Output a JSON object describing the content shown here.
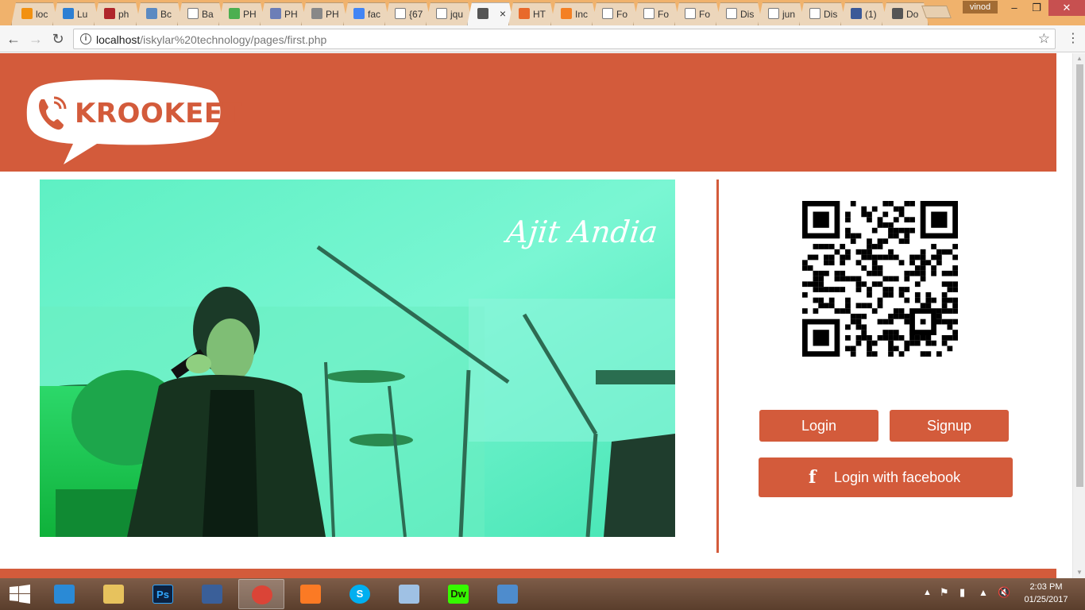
{
  "browser": {
    "tabs": [
      {
        "label": "loc",
        "icon": "phpmyadmin-icon",
        "color": "#f29111"
      },
      {
        "label": "Lu",
        "icon": "blue-app-icon",
        "color": "#2d7fd3"
      },
      {
        "label": "ph",
        "icon": "wdg-icon",
        "color": "#b0262b"
      },
      {
        "label": "Bc",
        "icon": "bootstrap-icon",
        "color": "#5b8ac2"
      },
      {
        "label": "Ba",
        "icon": "page-icon",
        "color": "#ffffff"
      },
      {
        "label": "PH",
        "icon": "w3-icon",
        "color": "#4caf50"
      },
      {
        "label": "PH",
        "icon": "php-icon",
        "color": "#6c7eb7"
      },
      {
        "label": "PH",
        "icon": "diamond-icon",
        "color": "#888888"
      },
      {
        "label": "fac",
        "icon": "google-icon",
        "color": "#4285f4"
      },
      {
        "label": "{67",
        "icon": "page-icon",
        "color": "#ffffff"
      },
      {
        "label": "jqu",
        "icon": "page-icon",
        "color": "#ffffff"
      },
      {
        "label": "",
        "icon": "speaker-icon",
        "color": "#555555",
        "active": true
      },
      {
        "label": "HT",
        "icon": "html-icon",
        "color": "#e8692b"
      },
      {
        "label": "Inc",
        "icon": "stackoverflow-icon",
        "color": "#f48024"
      },
      {
        "label": "Fo",
        "icon": "page-icon",
        "color": "#ffffff"
      },
      {
        "label": "Fo",
        "icon": "page-icon",
        "color": "#ffffff"
      },
      {
        "label": "Fo",
        "icon": "page-icon",
        "color": "#ffffff"
      },
      {
        "label": "Dis",
        "icon": "page-icon",
        "color": "#ffffff"
      },
      {
        "label": "jun",
        "icon": "page-icon",
        "color": "#ffffff"
      },
      {
        "label": "Dis",
        "icon": "page-icon",
        "color": "#ffffff"
      },
      {
        "label": "(1)",
        "icon": "facebook-icon",
        "color": "#3b5998"
      },
      {
        "label": "Do",
        "icon": "download-icon",
        "color": "#555555"
      }
    ],
    "user": "vinod",
    "url_host": "localhost",
    "url_path": "/iskylar%20technology/pages/first.php"
  },
  "site": {
    "brand": "KROOKEET",
    "hero_caption": "Ajit Andia",
    "login_label": "Login",
    "signup_label": "Signup",
    "facebook_label": "Login with facebook",
    "accent_color": "#d35b3b"
  },
  "taskbar": {
    "apps": [
      {
        "name": "start-button",
        "icon": "windows-icon"
      },
      {
        "name": "internet-explorer",
        "icon": "ie-icon",
        "color": "#2a8ad6"
      },
      {
        "name": "file-explorer",
        "icon": "folder-icon",
        "color": "#e7c25d"
      },
      {
        "name": "photoshop",
        "icon": "photoshop-icon",
        "color": "#0b2140",
        "text": "Ps"
      },
      {
        "name": "media-player",
        "icon": "media-player-icon",
        "color": "#3a5f99"
      },
      {
        "name": "chrome",
        "icon": "chrome-icon",
        "color": "#db4437"
      },
      {
        "name": "xampp",
        "icon": "xampp-icon",
        "color": "#fb7a24"
      },
      {
        "name": "skype",
        "icon": "skype-icon",
        "color": "#00aff0",
        "text": "S"
      },
      {
        "name": "virtualbox",
        "icon": "cube-icon",
        "color": "#9fc1e4"
      },
      {
        "name": "dreamweaver",
        "icon": "dreamweaver-icon",
        "color": "#35fa00",
        "text": "Dw"
      },
      {
        "name": "photos",
        "icon": "photo-icon",
        "color": "#4e8ccd"
      }
    ],
    "time": "2:03 PM",
    "date": "01/25/2017"
  }
}
